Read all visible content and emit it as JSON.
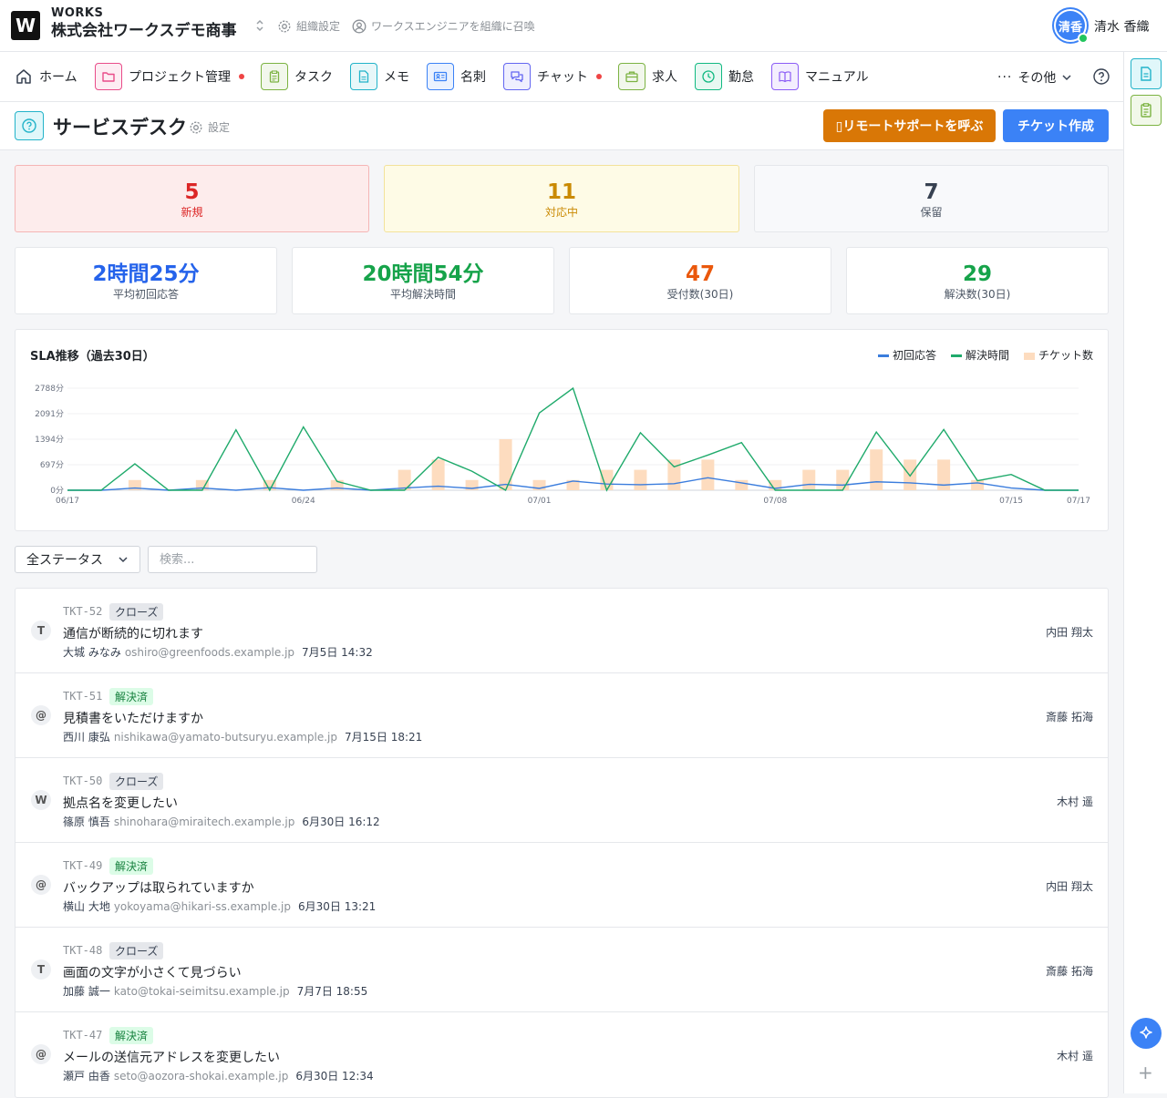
{
  "app": {
    "brand": "WORKS",
    "logo": "W",
    "company": "株式会社ワークスデモ商事",
    "org_settings": "組織設定",
    "invite": "ワークスエンジニアを組織に召喚",
    "user_initials": "清香",
    "user_name": "清水 香織"
  },
  "nav": {
    "home": "ホーム",
    "items": [
      {
        "label": "プロジェクト管理",
        "icon": "folder-icon",
        "color": "#e94c89",
        "dot": true
      },
      {
        "label": "タスク",
        "icon": "clipboard-icon",
        "color": "#7cb342",
        "dot": false
      },
      {
        "label": "メモ",
        "icon": "document-icon",
        "color": "#22b3c9",
        "dot": false
      },
      {
        "label": "名刺",
        "icon": "id-card-icon",
        "color": "#3b82f6",
        "dot": false
      },
      {
        "label": "チャット",
        "icon": "chat-icon",
        "color": "#6366f1",
        "dot": true
      },
      {
        "label": "求人",
        "icon": "briefcase-icon",
        "color": "#7cb342",
        "dot": false
      },
      {
        "label": "勤怠",
        "icon": "clock-icon",
        "color": "#10b981",
        "dot": false
      },
      {
        "label": "マニュアル",
        "icon": "book-icon",
        "color": "#8b5cf6",
        "dot": false
      }
    ],
    "more": "その他"
  },
  "page": {
    "title": "サービスデスク",
    "settings": "設定",
    "remote_btn": "▯リモートサポートを呼ぶ",
    "create_btn": "チケット作成"
  },
  "status_counts": [
    {
      "value": "5",
      "label": "新規"
    },
    {
      "value": "11",
      "label": "対応中"
    },
    {
      "value": "7",
      "label": "保留"
    }
  ],
  "metrics": [
    {
      "value": "2時間25分",
      "label": "平均初回応答"
    },
    {
      "value": "20時間54分",
      "label": "平均解決時間"
    },
    {
      "value": "47",
      "label": "受付数(30日)"
    },
    {
      "value": "29",
      "label": "解決数(30日)"
    }
  ],
  "chart_data": {
    "type": "line",
    "title": "SLA推移（過去30日）",
    "legend": [
      "初回応答",
      "解決時間",
      "チケット数"
    ],
    "colors": {
      "first": "#3b7ddd",
      "resolve": "#1faa6b",
      "tickets": "#fddcbf"
    },
    "y_ticks": [
      "0分",
      "697分",
      "1394分",
      "2091分",
      "2788分"
    ],
    "ylim": [
      0,
      2788
    ],
    "x_tick_labels": [
      "06/17",
      "06/24",
      "07/01",
      "07/08",
      "07/15",
      "07/17"
    ],
    "x_tick_index": [
      0,
      7,
      14,
      21,
      28,
      30
    ],
    "first_response": [
      0,
      0,
      60,
      0,
      60,
      0,
      70,
      0,
      60,
      0,
      60,
      110,
      50,
      160,
      50,
      250,
      170,
      150,
      180,
      340,
      200,
      50,
      160,
      140,
      230,
      200,
      140,
      200,
      60,
      0,
      0
    ],
    "resolution": [
      0,
      0,
      720,
      0,
      0,
      1650,
      0,
      1730,
      240,
      0,
      0,
      900,
      520,
      0,
      2110,
      2788,
      0,
      1570,
      640,
      960,
      1300,
      0,
      0,
      0,
      1590,
      390,
      1660,
      260,
      430,
      0,
      0
    ],
    "tickets": [
      0,
      0,
      1,
      0,
      1,
      0,
      1,
      0,
      1,
      0,
      2,
      3,
      1,
      5,
      1,
      1,
      2,
      2,
      3,
      3,
      1,
      1,
      2,
      2,
      4,
      3,
      3,
      1,
      0,
      0,
      0
    ]
  },
  "filter": {
    "status": "全ステータス",
    "search_placeholder": "検索..."
  },
  "tickets": [
    {
      "avatar": "T",
      "id": "TKT-52",
      "status": "クローズ",
      "title": "通信が断続的に切れます",
      "customer": "大城 みなみ",
      "email": "oshiro@greenfoods.example.jp",
      "time": "7月5日 14:32",
      "assignee": "内田 翔太"
    },
    {
      "avatar": "@",
      "id": "TKT-51",
      "status": "解決済",
      "title": "見積書をいただけますか",
      "customer": "西川 康弘",
      "email": "nishikawa@yamato-butsuryu.example.jp",
      "time": "7月15日 18:21",
      "assignee": "斎藤 拓海"
    },
    {
      "avatar": "W",
      "id": "TKT-50",
      "status": "クローズ",
      "title": "拠点名を変更したい",
      "customer": "篠原 慎吾",
      "email": "shinohara@miraitech.example.jp",
      "time": "6月30日 16:12",
      "assignee": "木村 遥"
    },
    {
      "avatar": "@",
      "id": "TKT-49",
      "status": "解決済",
      "title": "バックアップは取られていますか",
      "customer": "横山 大地",
      "email": "yokoyama@hikari-ss.example.jp",
      "time": "6月30日 13:21",
      "assignee": "内田 翔太"
    },
    {
      "avatar": "T",
      "id": "TKT-48",
      "status": "クローズ",
      "title": "画面の文字が小さくて見づらい",
      "customer": "加藤 誠一",
      "email": "kato@tokai-seimitsu.example.jp",
      "time": "7月7日 18:55",
      "assignee": "斎藤 拓海"
    },
    {
      "avatar": "@",
      "id": "TKT-47",
      "status": "解決済",
      "title": "メールの送信元アドレスを変更したい",
      "customer": "瀬戸 由香",
      "email": "seto@aozora-shokai.example.jp",
      "time": "6月30日 12:34",
      "assignee": "木村 遥"
    }
  ]
}
